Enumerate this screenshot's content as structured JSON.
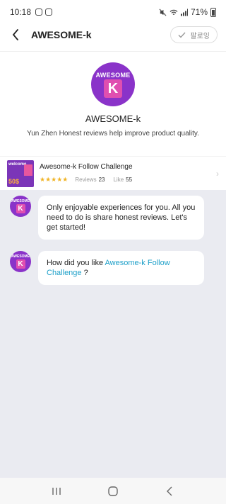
{
  "status_bar": {
    "time": "10:18",
    "battery_percent": "71%"
  },
  "header": {
    "title": "AWESOME-k",
    "follow_label": "팔로잉"
  },
  "profile": {
    "logo_word": "AWESOME",
    "logo_letter": "K",
    "name": "AWESOME-k",
    "description": "Yun Zhen Honest reviews help improve product quality."
  },
  "challenge": {
    "title": "Awesome-k Follow Challenge",
    "rating_stars": 5,
    "stars_text": "★★★★★",
    "reviews_label": "Reviews",
    "reviews_count": "23",
    "like_label": "Like",
    "like_count": "55",
    "thumb_text_top": "welcome",
    "thumb_text_bottom": "50$"
  },
  "messages": [
    {
      "text": "Only enjoyable experiences for you. All you need to do is share honest reviews. Let's get started!"
    },
    {
      "prefix": "How did you like ",
      "link_text": "Awesome-k Follow Challenge",
      "suffix": " ?"
    }
  ],
  "colors": {
    "brand_purple": "#8a33c9",
    "brand_pink": "#e04fb0",
    "link": "#1ea0c9",
    "chat_bg": "#eaebf1",
    "star": "#f0b323"
  }
}
